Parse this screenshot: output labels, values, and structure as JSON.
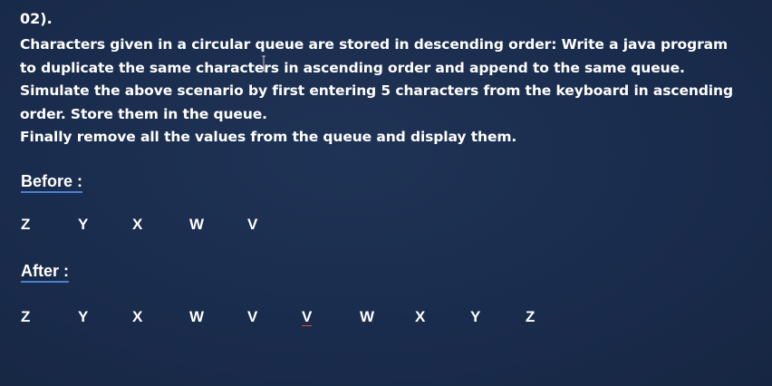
{
  "question": {
    "number": "02).",
    "lines": [
      "Characters given in a circular queue are stored in descending order: Write a java program",
      "to duplicate the same characters in ascending order and append to the same queue.",
      "Simulate the above scenario by first entering 5 characters from the keyboard in ascending",
      "order. Store them in the queue.",
      "Finally remove all the values from the queue and display them."
    ]
  },
  "before": {
    "label": "Before :",
    "chars": [
      "Z",
      "Y",
      "X",
      "W",
      "V"
    ]
  },
  "after": {
    "label": "After :",
    "chars": [
      "Z",
      "Y",
      "X",
      "W",
      "V",
      "V",
      "W",
      "X",
      "Y",
      "Z"
    ]
  },
  "colors": {
    "background": "#1a2c4d",
    "text": "#ffffff",
    "label_underline": "#4b7fd0",
    "spell_underline": "#e04040"
  }
}
